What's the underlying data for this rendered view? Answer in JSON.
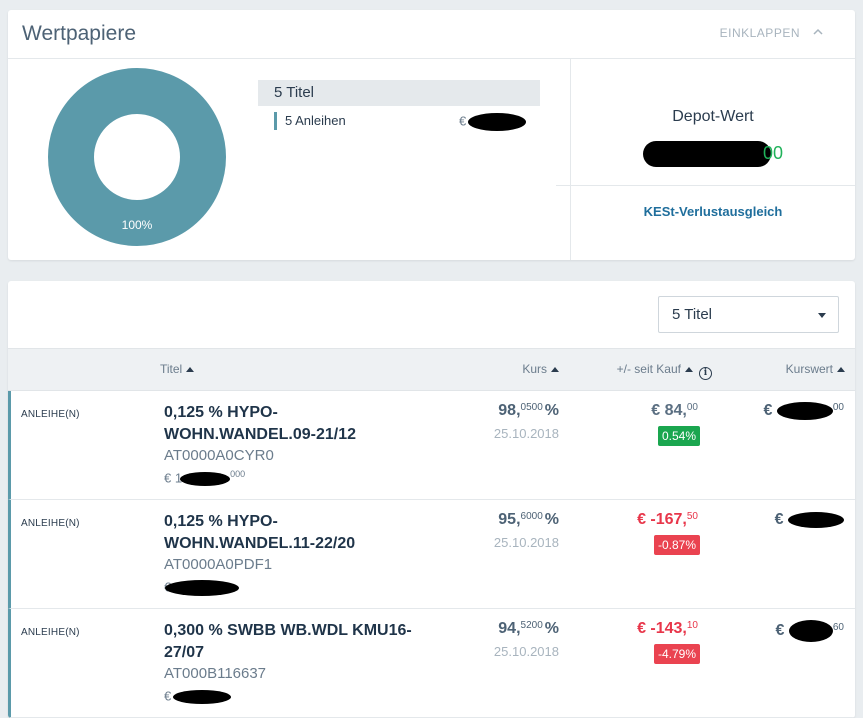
{
  "summary": {
    "title": "Wertpapiere",
    "collapse_label": "EINKLAPPEN",
    "donut": {
      "percent_label": "100%",
      "segments": [
        {
          "share": 1.0,
          "color": "#5b9aaa"
        }
      ]
    },
    "legend": {
      "header": "5 Titel",
      "items": [
        {
          "label": "5 Anleihen",
          "value": "€"
        }
      ]
    },
    "depot": {
      "label": "Depot-Wert",
      "value": "00"
    },
    "kest_link": "KESt-Verlustausgleich"
  },
  "holdings": {
    "filter_select": {
      "value": "5 Titel"
    },
    "columns": {
      "titel": "Titel",
      "kurs": "Kurs",
      "pl": "+/- seit Kauf",
      "kurswert": "Kurswert"
    },
    "rows": [
      {
        "type": "ANLEIHE(N)",
        "name": "0,125 % HYPO-WOHN.WANDEL.09-21/12",
        "isin": "AT0000A0CYR0",
        "nominal": "€ 1",
        "nominal_suffix": "000",
        "kurs_int": "98,",
        "kurs_dec": "0500",
        "kurs_unit": "%",
        "kurs_date": "25.10.2018",
        "pl_int": "€ 84,",
        "pl_dec": "00",
        "pl_pct": "0.54%",
        "pl_color": "#5b6f82",
        "badge_color": "#1aa64f",
        "kurswert": "€",
        "kurswert_suffix": "00"
      },
      {
        "type": "ANLEIHE(N)",
        "name": "0,125 % HYPO-WOHN.WANDEL.11-22/20",
        "isin": "AT0000A0PDF1",
        "nominal": "€",
        "nominal_suffix": "",
        "kurs_int": "95,",
        "kurs_dec": "6000",
        "kurs_unit": "%",
        "kurs_date": "25.10.2018",
        "pl_int": "€ -167,",
        "pl_dec": "50",
        "pl_pct": "-0.87%",
        "pl_color": "#e8364a",
        "badge_color": "#ea4350",
        "kurswert": "€",
        "kurswert_suffix": ""
      },
      {
        "type": "ANLEIHE(N)",
        "name": "0,300 % SWBB WB.WDL KMU16-27/07",
        "isin": "AT000B116637",
        "nominal": "€",
        "nominal_suffix": "",
        "kurs_int": "94,",
        "kurs_dec": "5200",
        "kurs_unit": "%",
        "kurs_date": "25.10.2018",
        "pl_int": "€ -143,",
        "pl_dec": "10",
        "pl_pct": "-4.79%",
        "pl_color": "#e8364a",
        "badge_color": "#ea4350",
        "kurswert": "€",
        "kurswert_suffix": "60"
      }
    ]
  }
}
